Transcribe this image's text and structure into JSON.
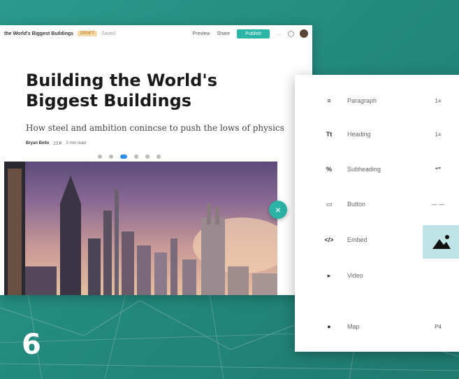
{
  "editor": {
    "doc_title": "the World's Biggest Buildings",
    "badge": "DRAFT",
    "status": "Saved",
    "nav": {
      "preview": "Preview",
      "share": "Share",
      "publish": "Publish",
      "more": "..."
    },
    "headline_line1": "Building the World's",
    "headline_line2": "Biggest Buildings",
    "subtitle": "How steel and ambition conincse to push the lows of physics",
    "byline": {
      "author": "Bryan Bello",
      "date": "23 ₽",
      "read": "3 min read"
    }
  },
  "close_button": "×",
  "insert_panel": {
    "items": [
      {
        "icon": "≡",
        "label": "Paragraph",
        "right_icon": "1≡"
      },
      {
        "icon": "Tt",
        "label": "Heading",
        "right_icon": "1≡"
      },
      {
        "icon": "%",
        "label": "Subheading",
        "right_icon": "❝❞"
      },
      {
        "icon": "▭",
        "label": "Button",
        "right_icon": "— —"
      },
      {
        "icon": "</>",
        "label": "Embed",
        "right_icon": "▲"
      },
      {
        "icon": "▸",
        "label": "Video",
        "right_icon": ""
      },
      {
        "icon": "●",
        "label": "Map",
        "right_icon": "P4"
      }
    ]
  },
  "step_number": "6",
  "colors": {
    "teal": "#2ab3a4",
    "bg": "#23877c",
    "image_tile": "#bfe3e6"
  }
}
